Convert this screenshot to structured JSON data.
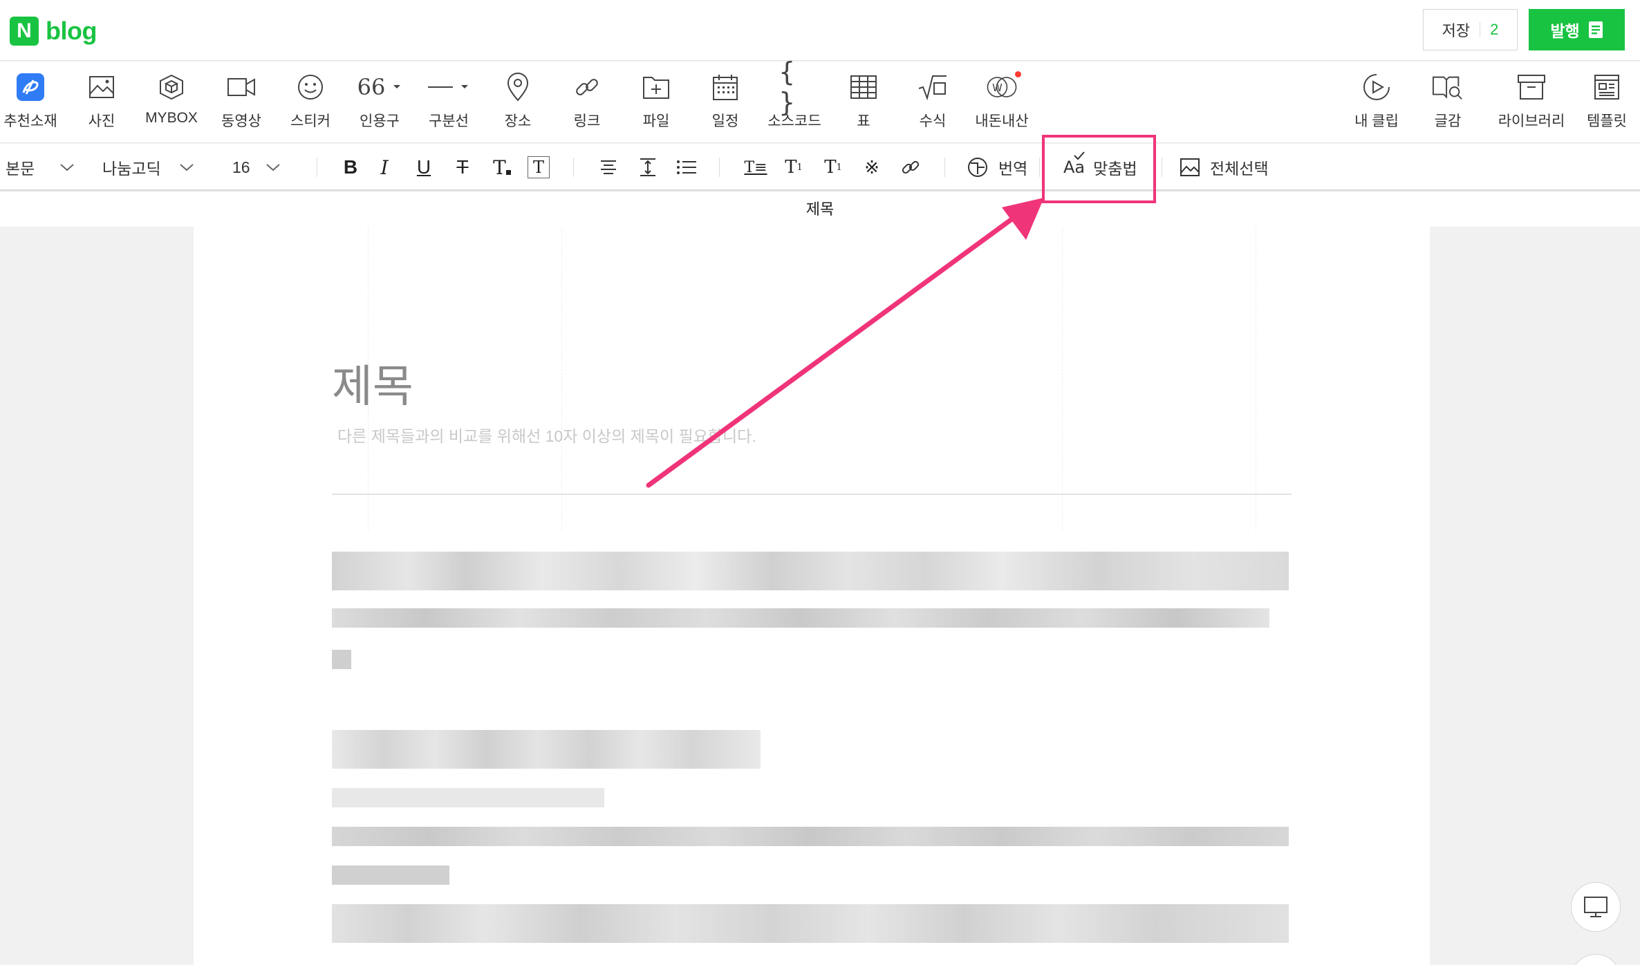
{
  "app": {
    "logo_badge": "N",
    "logo_text": "blog",
    "save_label": "저장",
    "save_count": "2",
    "publish_label": "발행"
  },
  "toolbar": {
    "items": [
      {
        "label": "추천소재",
        "icon": "recommend-icon"
      },
      {
        "label": "사진",
        "icon": "photo-icon"
      },
      {
        "label": "MYBOX",
        "icon": "mybox-icon"
      },
      {
        "label": "동영상",
        "icon": "video-icon"
      },
      {
        "label": "스티커",
        "icon": "sticker-icon"
      },
      {
        "label": "인용구",
        "icon": "quote-icon"
      },
      {
        "label": "구분선",
        "icon": "divider-icon"
      },
      {
        "label": "장소",
        "icon": "location-icon"
      },
      {
        "label": "링크",
        "icon": "link-icon"
      },
      {
        "label": "파일",
        "icon": "file-icon"
      },
      {
        "label": "일정",
        "icon": "calendar-icon"
      },
      {
        "label": "소스코드",
        "icon": "code-icon"
      },
      {
        "label": "표",
        "icon": "table-icon"
      },
      {
        "label": "수식",
        "icon": "formula-icon"
      },
      {
        "label": "내돈내산",
        "icon": "purchase-icon"
      }
    ],
    "right_items": [
      {
        "label": "내 클립",
        "icon": "clip-icon"
      },
      {
        "label": "글감",
        "icon": "material-search-icon"
      },
      {
        "label": "라이브러리",
        "icon": "library-icon"
      },
      {
        "label": "템플릿",
        "icon": "template-icon"
      }
    ],
    "quote_glyph": "66"
  },
  "format": {
    "paragraph_style": "본문",
    "font": "나눔고딕",
    "font_size": "16",
    "translate_label": "번역",
    "spellcheck_label": "맞춤법",
    "select_all_label": "전체선택"
  },
  "title_bar": "제목",
  "document": {
    "title_placeholder": "제목",
    "title_hint": "다른 제목들과의 비교를 위해선 10자 이상의 제목이 필요합니다."
  },
  "colors": {
    "brand_green": "#19c342",
    "highlight_pink": "#f0347a"
  }
}
